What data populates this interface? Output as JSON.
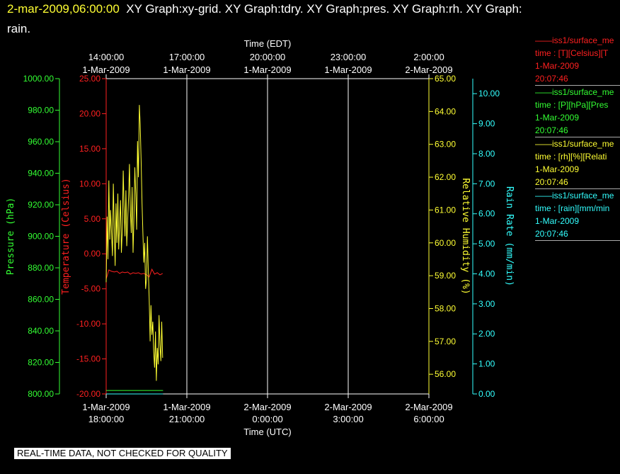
{
  "header": {
    "datetime": "2-mar-2009,06:00:00",
    "line1_rest": "XY Graph:xy-grid.  XY Graph:tdry.  XY Graph:pres.  XY Graph:rh.  XY Graph:",
    "line2": "rain."
  },
  "footer": {
    "notice": "REAL-TIME DATA, NOT CHECKED FOR QUALITY"
  },
  "legend": [
    {
      "line1": "——iss1/surface_me",
      "line2": "time : [T][Celsius][T",
      "line3": "1-Mar-2009",
      "line4": "20:07:46",
      "color": "#ff2020"
    },
    {
      "line1": "——iss1/surface_me",
      "line2": "time : [P][hPa][Pres",
      "line3": "1-Mar-2009",
      "line4": "20:07:46",
      "color": "#33ff33"
    },
    {
      "line1": "——iss1/surface_me",
      "line2": "time : [rh][%][Relati",
      "line3": "1-Mar-2009",
      "line4": "20:07:46",
      "color": "#ffff33"
    },
    {
      "line1": "——iss1/surface_me",
      "line2": "time : [rain][mm/min",
      "line3": "1-Mar-2009",
      "line4": "20:07:46",
      "color": "#33ffff"
    }
  ],
  "chart_data": {
    "type": "line",
    "colors": {
      "temperature": "#ff2020",
      "pressure": "#33ff33",
      "rh": "#ffff33",
      "rain": "#33ffff",
      "grid": "#ffffff"
    },
    "x_top": {
      "label": "Time (EDT)",
      "ticks": [
        {
          "time": "14:00:00",
          "date": "1-Mar-2009"
        },
        {
          "time": "17:00:00",
          "date": "1-Mar-2009"
        },
        {
          "time": "20:00:00",
          "date": "1-Mar-2009"
        },
        {
          "time": "23:00:00",
          "date": "1-Mar-2009"
        },
        {
          "time": "2:00:00",
          "date": "2-Mar-2009"
        }
      ]
    },
    "x_bottom": {
      "label": "Time (UTC)",
      "range": [
        "1-Mar-2009 18:00:00",
        "2-Mar-2009 06:00:00"
      ],
      "ticks": [
        {
          "date": "1-Mar-2009",
          "time": "18:00:00"
        },
        {
          "date": "1-Mar-2009",
          "time": "21:00:00"
        },
        {
          "date": "2-Mar-2009",
          "time": "0:00:00"
        },
        {
          "date": "2-Mar-2009",
          "time": "3:00:00"
        },
        {
          "date": "2-Mar-2009",
          "time": "6:00:00"
        }
      ]
    },
    "axes": {
      "pressure": {
        "label": "Pressure (hPa)",
        "range": [
          800,
          1000
        ],
        "ticks": [
          "800.00",
          "820.00",
          "840.00",
          "860.00",
          "880.00",
          "900.00",
          "920.00",
          "940.00",
          "960.00",
          "980.00",
          "1000.00"
        ]
      },
      "temperature": {
        "label": "Temperature (Celsius)",
        "range": [
          -20,
          25
        ],
        "ticks": [
          "-20.00",
          "-15.00",
          "-10.00",
          "-5.00",
          "0.00",
          "5.00",
          "10.00",
          "15.00",
          "20.00",
          "25.00"
        ]
      },
      "rh": {
        "label": "Relative Humidity (%)",
        "range": [
          55.4,
          65
        ],
        "ticks": [
          "56.00",
          "57.00",
          "58.00",
          "59.00",
          "60.00",
          "61.00",
          "62.00",
          "63.00",
          "64.00",
          "65.00"
        ]
      },
      "rain": {
        "label": "Rain Rate (mm/min)",
        "range": [
          0,
          10.5
        ],
        "ticks": [
          "0.00",
          "1.00",
          "2.00",
          "3.00",
          "4.00",
          "5.00",
          "6.00",
          "7.00",
          "8.00",
          "9.00",
          "10.00"
        ]
      }
    },
    "series": [
      {
        "key": "temperature",
        "x": [
          "1-Mar-2009 18:00",
          "1-Mar-2009 18:06",
          "1-Mar-2009 18:12",
          "1-Mar-2009 18:18",
          "1-Mar-2009 18:24",
          "1-Mar-2009 18:30",
          "1-Mar-2009 18:36",
          "1-Mar-2009 18:42",
          "1-Mar-2009 18:48",
          "1-Mar-2009 18:54",
          "1-Mar-2009 19:00",
          "1-Mar-2009 19:06",
          "1-Mar-2009 19:12",
          "1-Mar-2009 19:18",
          "1-Mar-2009 19:24",
          "1-Mar-2009 19:30",
          "1-Mar-2009 19:36",
          "1-Mar-2009 19:42",
          "1-Mar-2009 19:48",
          "1-Mar-2009 19:54",
          "1-Mar-2009 20:00",
          "1-Mar-2009 20:06"
        ],
        "y": [
          -3.6,
          -2.3,
          -2.5,
          -2.6,
          -2.5,
          -2.8,
          -2.6,
          -2.7,
          -2.6,
          -2.9,
          -2.7,
          -2.8,
          -2.7,
          -2.9,
          -2.8,
          -3.0,
          -3.3,
          -2.2,
          -2.9,
          -2.7,
          -3.0,
          -2.8
        ]
      },
      {
        "key": "pressure",
        "x": [
          "1-Mar-2009 18:00",
          "1-Mar-2009 20:07"
        ],
        "y": [
          802.2,
          802.2
        ]
      },
      {
        "key": "rh",
        "x": [
          "1-Mar-2009 18:00",
          "1-Mar-2009 18:02",
          "1-Mar-2009 18:04",
          "1-Mar-2009 18:06",
          "1-Mar-2009 18:08",
          "1-Mar-2009 18:10",
          "1-Mar-2009 18:12",
          "1-Mar-2009 18:14",
          "1-Mar-2009 18:16",
          "1-Mar-2009 18:18",
          "1-Mar-2009 18:20",
          "1-Mar-2009 18:22",
          "1-Mar-2009 18:24",
          "1-Mar-2009 18:26",
          "1-Mar-2009 18:28",
          "1-Mar-2009 18:30",
          "1-Mar-2009 18:32",
          "1-Mar-2009 18:34",
          "1-Mar-2009 18:36",
          "1-Mar-2009 18:38",
          "1-Mar-2009 18:40",
          "1-Mar-2009 18:42",
          "1-Mar-2009 18:44",
          "1-Mar-2009 18:46",
          "1-Mar-2009 18:48",
          "1-Mar-2009 18:50",
          "1-Mar-2009 18:52",
          "1-Mar-2009 18:54",
          "1-Mar-2009 18:56",
          "1-Mar-2009 18:58",
          "1-Mar-2009 19:00",
          "1-Mar-2009 19:02",
          "1-Mar-2009 19:04",
          "1-Mar-2009 19:06",
          "1-Mar-2009 19:08",
          "1-Mar-2009 19:10",
          "1-Mar-2009 19:12",
          "1-Mar-2009 19:14",
          "1-Mar-2009 19:16",
          "1-Mar-2009 19:18",
          "1-Mar-2009 19:20",
          "1-Mar-2009 19:22",
          "1-Mar-2009 19:24",
          "1-Mar-2009 19:26",
          "1-Mar-2009 19:28",
          "1-Mar-2009 19:30",
          "1-Mar-2009 19:32",
          "1-Mar-2009 19:34",
          "1-Mar-2009 19:36",
          "1-Mar-2009 19:38",
          "1-Mar-2009 19:40",
          "1-Mar-2009 19:42",
          "1-Mar-2009 19:44",
          "1-Mar-2009 19:46",
          "1-Mar-2009 19:48",
          "1-Mar-2009 19:50",
          "1-Mar-2009 19:52",
          "1-Mar-2009 19:54",
          "1-Mar-2009 19:56",
          "1-Mar-2009 19:58",
          "1-Mar-2009 20:00",
          "1-Mar-2009 20:02",
          "1-Mar-2009 20:04",
          "1-Mar-2009 20:06"
        ],
        "y": [
          58.8,
          60.8,
          59.5,
          61.9,
          60.1,
          61.0,
          60.3,
          59.6,
          61.8,
          60.5,
          59.3,
          61.2,
          60.0,
          61.5,
          59.8,
          60.6,
          61.3,
          59.7,
          60.4,
          62.2,
          61.1,
          60.2,
          61.6,
          59.9,
          60.7,
          61.4,
          62.4,
          61.0,
          60.3,
          61.7,
          59.7,
          60.8,
          62.3,
          61.5,
          60.4,
          63.1,
          62.0,
          64.2,
          63.6,
          62.5,
          61.2,
          60.3,
          59.4,
          60.0,
          58.6,
          58.9,
          60.2,
          59.2,
          58.3,
          57.0,
          58.1,
          57.2,
          57.6,
          56.7,
          56.2,
          57.3,
          55.8,
          56.8,
          56.3,
          57.8,
          56.9,
          56.4,
          57.6,
          56.5
        ]
      },
      {
        "key": "rain",
        "x": [
          "1-Mar-2009 18:00",
          "1-Mar-2009 20:07"
        ],
        "y": [
          0,
          0
        ]
      }
    ]
  }
}
